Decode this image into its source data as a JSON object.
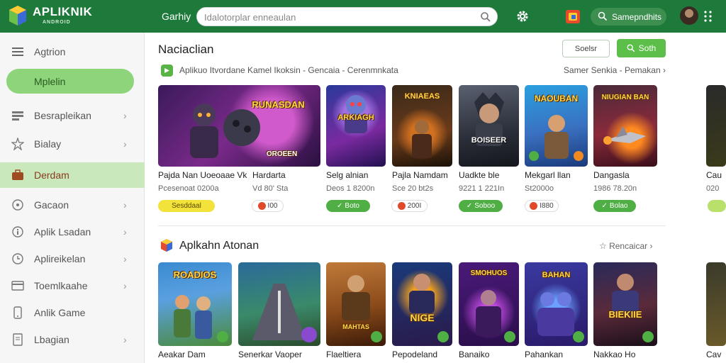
{
  "header": {
    "brand": "APLIKNIK",
    "brand_sub": "ANDROID",
    "menu_label": "Garhiy",
    "search_placeholder": "Idalotorplar enneaulan",
    "signin_label": "Samepndhits"
  },
  "sidebar": {
    "items": [
      {
        "label": "Agtrion",
        "icon": "menu-icon"
      },
      {
        "label": "Mplelin",
        "icon": "home-icon"
      },
      {
        "label": "Besrapleikan",
        "icon": "grid-icon"
      },
      {
        "label": "Bialay",
        "icon": "star-icon"
      },
      {
        "label": "Derdam",
        "icon": "briefcase-icon"
      },
      {
        "label": "Gacaon",
        "icon": "compass-icon"
      },
      {
        "label": "Aplik Lsadan",
        "icon": "info-icon"
      },
      {
        "label": "Aplireikelan",
        "icon": "clock-icon"
      },
      {
        "label": "Toemlkaahe",
        "icon": "card-icon"
      },
      {
        "label": "Anlik Game",
        "icon": "phone-icon"
      },
      {
        "label": "Lbagian",
        "icon": "doc-icon"
      }
    ]
  },
  "section1": {
    "title": "Naciaclian",
    "btn_outline": "Soelsr",
    "btn_green": "Soth",
    "subtitle": "Aplikuo Itvordane Kamel Ikoksin  -  Gencaia  -  Cerenmnkata",
    "subtitle_right": "Samer Senkia  -  Pemakan",
    "cards": [
      {
        "name": "Pajda Nan Uoeoaae Vk",
        "meta": "Pcesenoat 0200a",
        "badge": "Sesddaal",
        "badge_style": "yellow",
        "thumb_title": "RUNASDAN",
        "thumb_sub": "OROEEN"
      },
      {
        "name": "Hardarta",
        "meta": "Vd 80' Sta",
        "badge": "I00",
        "badge_style": "white",
        "thumb_title": "ARKIAGH",
        "thumb_sub": ""
      },
      {
        "name": "Selg alnian",
        "meta": "Deos 1 8200n",
        "badge": "Boto",
        "badge_style": "green",
        "thumb_title": "KNIAEAS",
        "thumb_sub": ""
      },
      {
        "name": "Pajla Namdam",
        "meta": "Sce 20 bt2s",
        "badge": "200I",
        "badge_style": "white",
        "thumb_title": "",
        "thumb_sub": "BOISEER"
      },
      {
        "name": "Uadkte ble",
        "meta": "9221 1 221In",
        "badge": "Soboo",
        "badge_style": "green",
        "thumb_title": "NAOUBAN",
        "thumb_sub": ""
      },
      {
        "name": "Mekgarl llan",
        "meta": "St2000o",
        "badge": "I880",
        "badge_style": "white",
        "thumb_title": "",
        "thumb_sub": ""
      },
      {
        "name": "Dangasla",
        "meta": "1986 78.20n",
        "badge": "Bolao",
        "badge_style": "green",
        "thumb_title": "NIUGIAN BAN",
        "thumb_sub": ""
      }
    ]
  },
  "section2": {
    "title": "Aplkahn Atonan",
    "right": "Rencaicar",
    "cards": [
      {
        "name": "Aeakar Dam",
        "thumb_title": "ROADIOS"
      },
      {
        "name": "Senerkar Vaoper",
        "thumb_title": ""
      },
      {
        "name": "Flaeltiera",
        "thumb_title": "MAHTAS"
      },
      {
        "name": "Pepodeland",
        "thumb_title": "NIGE"
      },
      {
        "name": "Banaiko",
        "thumb_title": "SMOHUOS"
      },
      {
        "name": "Pahankan",
        "thumb_title": "BAHAN"
      },
      {
        "name": "Nakkao Ho",
        "thumb_title": "BIEKIIE"
      }
    ]
  },
  "peek": {
    "name1": "Cau",
    "meta1": "020",
    "name2": "Cav"
  },
  "colors": {
    "header_bg": "#1e7a3a",
    "accent_green": "#5bbf4a",
    "pill_green": "#8dd47a"
  }
}
